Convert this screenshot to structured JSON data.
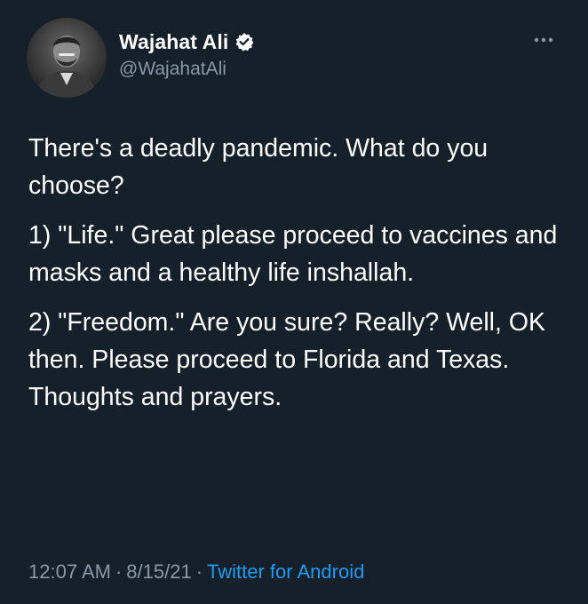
{
  "author": {
    "display_name": "Wajahat Ali",
    "handle": "@WajahatAli",
    "verified": true,
    "avatar_icon": "profile-photo"
  },
  "tweet": {
    "paragraphs": [
      "There's a deadly pandemic. What do you choose?",
      "1) \"Life.\" Great please proceed to vaccines and masks and a healthy life inshallah.",
      "2) \"Freedom.\" Are you sure? Really? Well, OK then. Please proceed to Florida and Texas. Thoughts and prayers."
    ],
    "time": "12:07 AM",
    "date": "8/15/21",
    "separator": "·",
    "source": "Twitter for Android"
  },
  "icons": {
    "more": "more-dots-icon",
    "verified": "verified-badge-icon"
  },
  "colors": {
    "background": "#15202b",
    "text": "#ffffff",
    "secondary": "#8b98a5",
    "link": "#1d9bf0"
  }
}
